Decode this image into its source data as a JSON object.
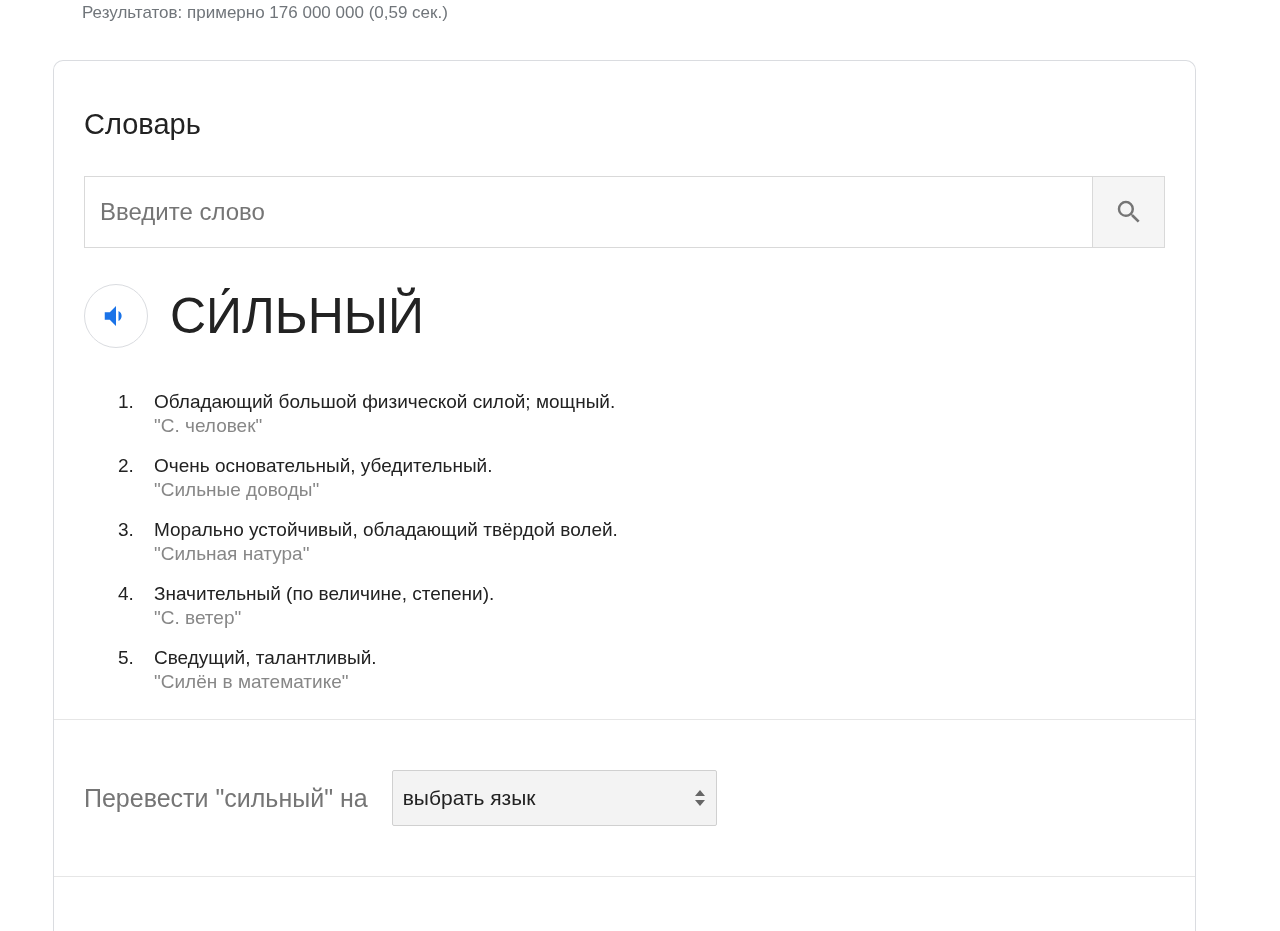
{
  "result_stats": "Результатов: примерно 176 000 000 (0,59 сек.)",
  "dictionary": {
    "title": "Словарь",
    "search": {
      "placeholder": "Введите слово"
    },
    "headword": "СИ́ЛЬНЫЙ",
    "definitions": [
      {
        "number": "1.",
        "text": "Обладающий большой физической силой; мощный.",
        "example": "\"С. человек\""
      },
      {
        "number": "2.",
        "text": "Очень основательный, убедительный.",
        "example": "\"Сильные доводы\""
      },
      {
        "number": "3.",
        "text": "Морально устойчивый, обладающий твёрдой волей.",
        "example": "\"Сильная натура\""
      },
      {
        "number": "4.",
        "text": "Значительный (по величине, степени).",
        "example": "\"С. ветер\""
      },
      {
        "number": "5.",
        "text": "Сведущий, талантливый.",
        "example": "\"Силён в математике\""
      }
    ],
    "translate": {
      "label": "Перевести \"сильный\" на",
      "select_value": "выбрать язык"
    }
  }
}
